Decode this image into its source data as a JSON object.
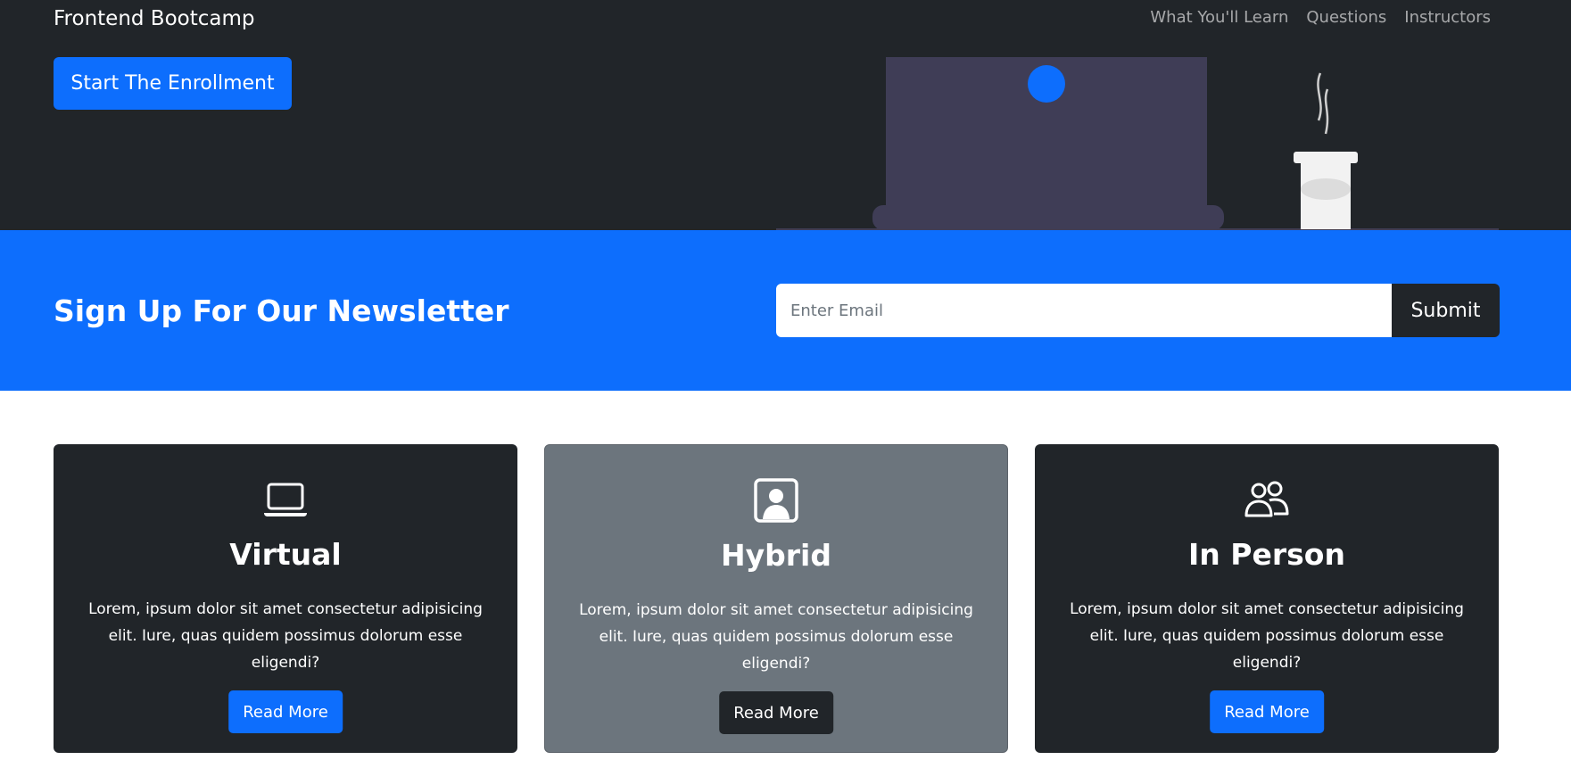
{
  "navbar": {
    "brand": "Frontend Bootcamp",
    "links": [
      "What You'll Learn",
      "Questions",
      "Instructors"
    ]
  },
  "hero": {
    "cta_label": "Start The Enrollment"
  },
  "newsletter": {
    "title": "Sign Up For Our Newsletter",
    "email_placeholder": "Enter Email",
    "submit_label": "Submit"
  },
  "cards": [
    {
      "icon": "laptop-icon",
      "title": "Virtual",
      "text": "Lorem, ipsum dolor sit amet consectetur adipisicing elit. Iure, quas quidem possimus dolorum esse eligendi?",
      "button_label": "Read More"
    },
    {
      "icon": "person-square-icon",
      "title": "Hybrid",
      "text": "Lorem, ipsum dolor sit amet consectetur adipisicing elit. Iure, quas quidem possimus dolorum esse eligendi?",
      "button_label": "Read More"
    },
    {
      "icon": "people-icon",
      "title": "In Person",
      "text": "Lorem, ipsum dolor sit amet consectetur adipisicing elit. Iure, quas quidem possimus dolorum esse eligendi?",
      "button_label": "Read More"
    }
  ],
  "colors": {
    "dark": "#212529",
    "primary": "#0d6efd",
    "secondary": "#6c757d",
    "white": "#ffffff"
  }
}
